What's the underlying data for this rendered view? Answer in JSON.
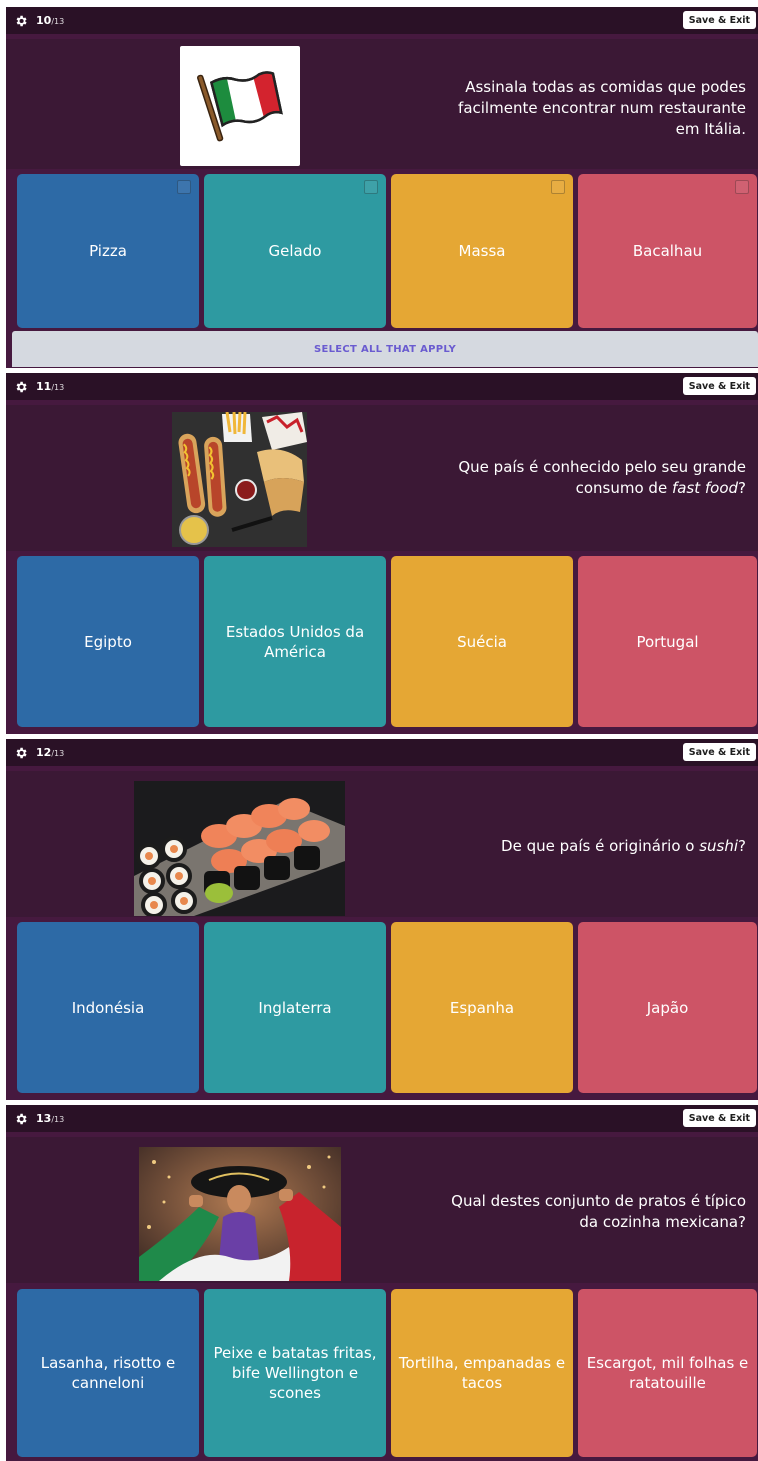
{
  "colors": {
    "blue": "#2d6aa6",
    "teal": "#2e9aa1",
    "yellow": "#e5a734",
    "red": "#cd5466"
  },
  "save_label": "Save & Exit",
  "questions": [
    {
      "current": "10",
      "total": "/13",
      "text": "Assinala todas as comidas que podes facilmente encontrar num restaurante em Itália.",
      "image": "italian-flag",
      "options": [
        "Pizza",
        "Gelado",
        "Massa",
        "Bacalhau"
      ],
      "hint": "SELECT ALL THAT APPLY"
    },
    {
      "current": "11",
      "total": "/13",
      "text_before": "Que país é conhecido pelo seu grande consumo de ",
      "text_em": "fast food",
      "text_after": "?",
      "image": "fast-food-photo",
      "options": [
        "Egipto",
        "Estados Unidos da América",
        "Suécia",
        "Portugal"
      ]
    },
    {
      "current": "12",
      "total": "/13",
      "text_before": "De que país é originário o ",
      "text_em": "sushi",
      "text_after": "?",
      "image": "sushi-photo",
      "options": [
        "Indonésia",
        "Inglaterra",
        "Espanha",
        "Japão"
      ]
    },
    {
      "current": "13",
      "total": "/13",
      "text": "Qual destes conjunto de pratos é típico da cozinha mexicana?",
      "image": "mariachi-photo",
      "options": [
        "Lasanha, risotto e canneloni",
        "Peixe e batatas fritas, bife Wellington e scones",
        "Tortilha, empanadas e tacos",
        "Escargot, mil folhas e ratatouille"
      ]
    }
  ]
}
